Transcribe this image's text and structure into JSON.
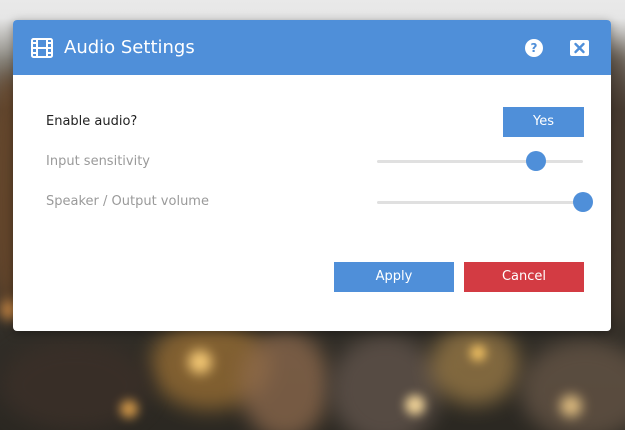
{
  "dialog": {
    "title": "Audio Settings",
    "title_icon": "film-icon",
    "help_label": "?",
    "close_icon": "close-icon"
  },
  "settings": {
    "enable_audio": {
      "label": "Enable audio?",
      "button_label": "Yes"
    },
    "input_sensitivity": {
      "label": "Input sensitivity",
      "value": 0.77
    },
    "output_volume": {
      "label": "Speaker / Output volume",
      "value": 1.0
    }
  },
  "actions": {
    "apply_label": "Apply",
    "cancel_label": "Cancel"
  },
  "colors": {
    "accent": "#4f8fd9",
    "danger": "#d33b43",
    "track": "#e0e0e0",
    "label_dark": "#222222",
    "label_muted": "#9a9a9a"
  }
}
